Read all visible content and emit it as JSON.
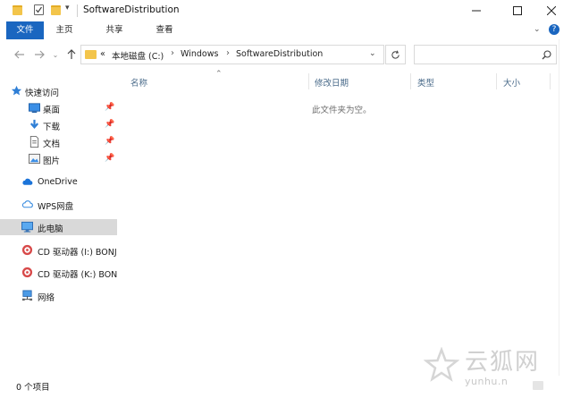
{
  "window": {
    "title": "SoftwareDistribution",
    "controls": {
      "minimize": "—",
      "maximize": "☐",
      "close": "✕"
    }
  },
  "ribbon": {
    "tabs": [
      "文件",
      "主页",
      "共享",
      "查看"
    ]
  },
  "address": {
    "overflow": "«",
    "crumbs": [
      "本地磁盘 (C:)",
      "Windows",
      "SoftwareDistribution"
    ]
  },
  "sidebar": {
    "items": [
      {
        "label": "快速访问",
        "icon": "star-icon",
        "pinned": false
      },
      {
        "label": "桌面",
        "icon": "desktop-icon",
        "pinned": true
      },
      {
        "label": "下载",
        "icon": "download-icon",
        "pinned": true
      },
      {
        "label": "文档",
        "icon": "document-icon",
        "pinned": true
      },
      {
        "label": "图片",
        "icon": "pictures-icon",
        "pinned": true
      },
      {
        "label": "OneDrive",
        "icon": "cloud-icon",
        "pinned": false
      },
      {
        "label": "WPS网盘",
        "icon": "cloud-icon",
        "pinned": false
      },
      {
        "label": "此电脑",
        "icon": "computer-icon",
        "pinned": false
      },
      {
        "label": "CD 驱动器 (I:) BONJ",
        "icon": "cd-drive-icon",
        "pinned": false
      },
      {
        "label": "CD 驱动器 (K:) BON",
        "icon": "cd-drive-icon",
        "pinned": false
      },
      {
        "label": "网络",
        "icon": "network-icon",
        "pinned": false
      }
    ],
    "selected": "此电脑"
  },
  "content": {
    "columns": [
      "名称",
      "修改日期",
      "类型",
      "大小"
    ],
    "empty_message": "此文件夹为空。"
  },
  "status": {
    "item_count": "0 个项目"
  },
  "watermark": {
    "text": "云狐网",
    "url": "yunhu.n"
  },
  "colors": {
    "accent": "#1a66c0",
    "selected_bg": "#d9d9d9",
    "folder": "#f3c54b"
  }
}
